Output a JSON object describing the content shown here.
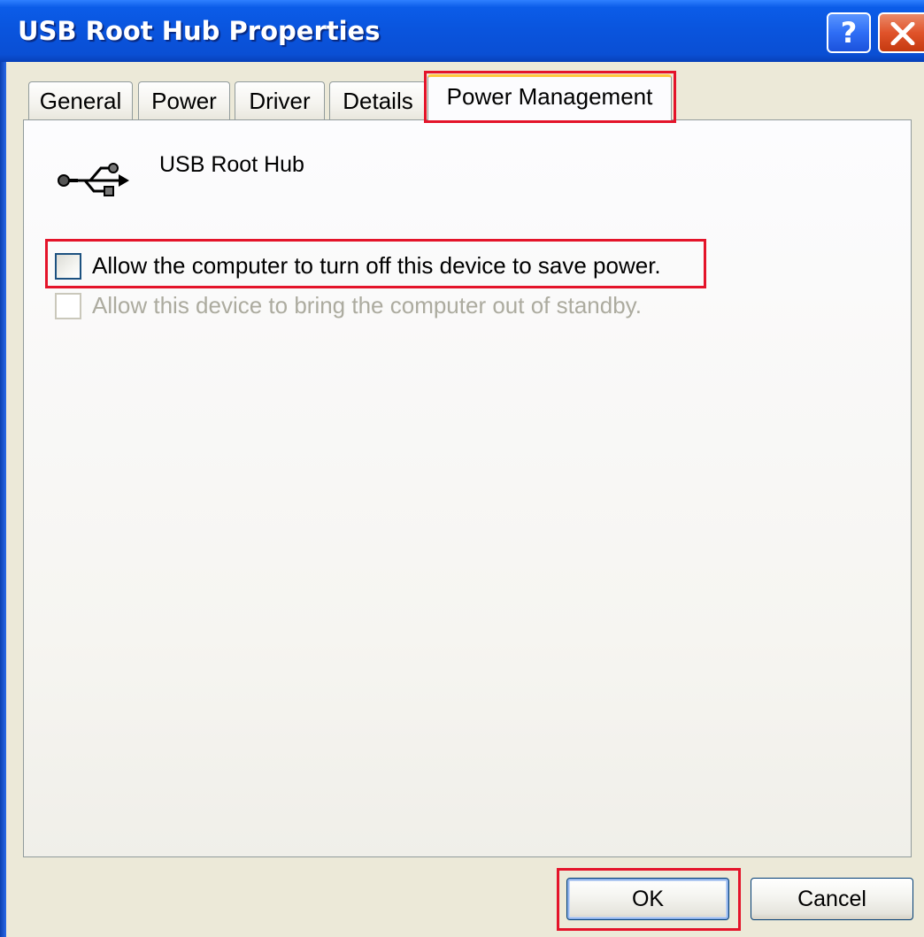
{
  "window": {
    "title": "USB Root Hub Properties",
    "help_glyph": "?"
  },
  "tabs": [
    {
      "label": "General",
      "selected": false
    },
    {
      "label": "Power",
      "selected": false
    },
    {
      "label": "Driver",
      "selected": false
    },
    {
      "label": "Details",
      "selected": false
    },
    {
      "label": "Power Management",
      "selected": true
    }
  ],
  "device": {
    "icon": "usb-icon",
    "name": "USB Root Hub"
  },
  "options": [
    {
      "label": "Allow the computer to turn off this device to save power.",
      "checked": false,
      "enabled": true
    },
    {
      "label": "Allow this device to bring the computer out of standby.",
      "checked": false,
      "enabled": false
    }
  ],
  "buttons": {
    "ok": "OK",
    "cancel": "Cancel"
  },
  "colors": {
    "titlebar": "#0a54dd",
    "highlight": "#e4142a",
    "active_tab_accent": "#ffc83c",
    "disabled_text": "#acab9f"
  }
}
